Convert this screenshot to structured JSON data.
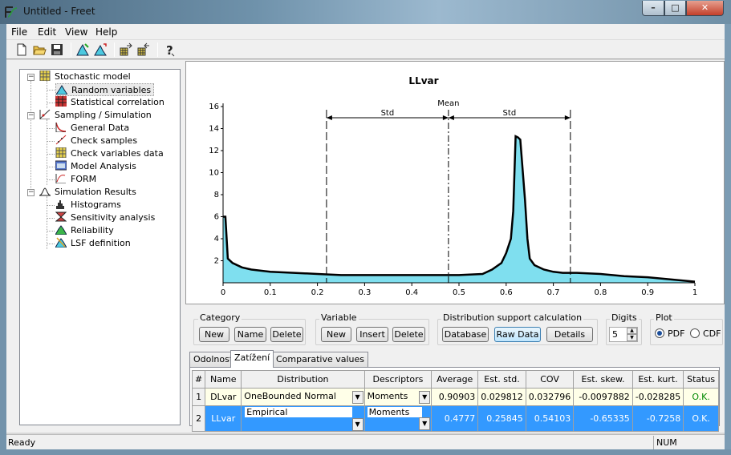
{
  "window": {
    "title": "Untitled - Freet",
    "minimize": "–",
    "maximize": "□",
    "close": "✕"
  },
  "menu": [
    {
      "label": "File"
    },
    {
      "label": "Edit"
    },
    {
      "label": "View"
    },
    {
      "label": "Help"
    }
  ],
  "toolbar": {
    "icons": [
      "new-file-icon",
      "open-folder-icon",
      "save-disk-icon",
      "histogram-tool-icon",
      "histogram-fit-icon",
      "grid-export-icon",
      "grid-import-icon",
      "help-question-icon"
    ]
  },
  "tree": {
    "groups": [
      {
        "label": "Stochastic model",
        "children": [
          "Random variables",
          "Statistical correlation"
        ]
      },
      {
        "label": "Sampling / Simulation",
        "children": [
          "General Data",
          "Check samples",
          "Check variables data",
          "Model Analysis",
          "FORM"
        ]
      },
      {
        "label": "Simulation Results",
        "children": [
          "Histograms",
          "Sensitivity analysis",
          "Reliability",
          "LSF definition"
        ]
      }
    ],
    "expander": "−"
  },
  "chart_data": {
    "type": "area",
    "title": "LLvar",
    "x_ticks": [
      "0",
      "0.1",
      "0.2",
      "0.3",
      "0.4",
      "0.5",
      "0.6",
      "0.7",
      "0.8",
      "0.9",
      "1"
    ],
    "y_ticks": [
      "2",
      "4",
      "6",
      "8",
      "10",
      "12",
      "14",
      "16"
    ],
    "xlim": [
      0,
      1
    ],
    "ylim": [
      0,
      16
    ],
    "x": [
      0,
      0.005,
      0.01,
      0.02,
      0.04,
      0.06,
      0.08,
      0.1,
      0.15,
      0.2,
      0.25,
      0.3,
      0.35,
      0.4,
      0.45,
      0.5,
      0.55,
      0.57,
      0.59,
      0.6,
      0.61,
      0.615,
      0.62,
      0.625,
      0.63,
      0.64,
      0.645,
      0.65,
      0.66,
      0.68,
      0.7,
      0.72,
      0.75,
      0.8,
      0.85,
      0.9,
      0.95,
      1.0
    ],
    "y": [
      6,
      6,
      2.2,
      1.8,
      1.4,
      1.2,
      1.1,
      1.0,
      0.9,
      0.8,
      0.7,
      0.7,
      0.7,
      0.7,
      0.7,
      0.7,
      0.8,
      1.2,
      1.8,
      2.7,
      4.0,
      6.5,
      13.3,
      13.2,
      13.0,
      7.5,
      4.0,
      2.2,
      1.6,
      1.2,
      1.0,
      0.9,
      0.9,
      0.8,
      0.6,
      0.5,
      0.3,
      0.1
    ],
    "annotations": {
      "mean_label": "Mean",
      "std_left": "Std",
      "std_right": "Std",
      "mean_x": 0.4777,
      "std": 0.25845
    },
    "fill_color": "#7fdfef",
    "line_color": "#000000",
    "grid": false
  },
  "panel": {
    "category": {
      "label": "Category",
      "buttons": [
        "New",
        "Name",
        "Delete"
      ]
    },
    "variable": {
      "label": "Variable",
      "buttons": [
        "New",
        "Insert",
        "Delete"
      ]
    },
    "distribution": {
      "label": "Distribution support calculation",
      "buttons": [
        "Database",
        "Raw Data",
        "Details"
      ]
    },
    "digits": {
      "label": "Digits",
      "value": "5"
    },
    "plot": {
      "label": "Plot",
      "options": [
        "PDF",
        "CDF"
      ],
      "selected": "PDF"
    }
  },
  "tabs": [
    {
      "label": "Odolnost"
    },
    {
      "label": "Zatížení"
    },
    {
      "label": "Comparative values"
    }
  ],
  "active_tab": "Zatížení",
  "table": {
    "headers": [
      "#",
      "Name",
      "Distribution",
      "Descriptors",
      "Average",
      "Est. std.",
      "COV",
      "Est. skew.",
      "Est. kurt.",
      "Status"
    ],
    "rows": [
      [
        "1",
        "DLvar",
        "OneBounded Normal",
        "Moments",
        "0.90903",
        "0.029812",
        "0.032796",
        "-0.0097882",
        "-0.028285",
        "O.K."
      ],
      [
        "2",
        "LLvar",
        "Empirical",
        "Moments",
        "0.4777",
        "0.25845",
        "0.54103",
        "-0.65335",
        "-0.7258",
        "O.K."
      ]
    ]
  },
  "status": {
    "text": "Ready",
    "num": "NUM"
  },
  "colors": {
    "accent": "#3399ff",
    "ok": "#008800"
  }
}
